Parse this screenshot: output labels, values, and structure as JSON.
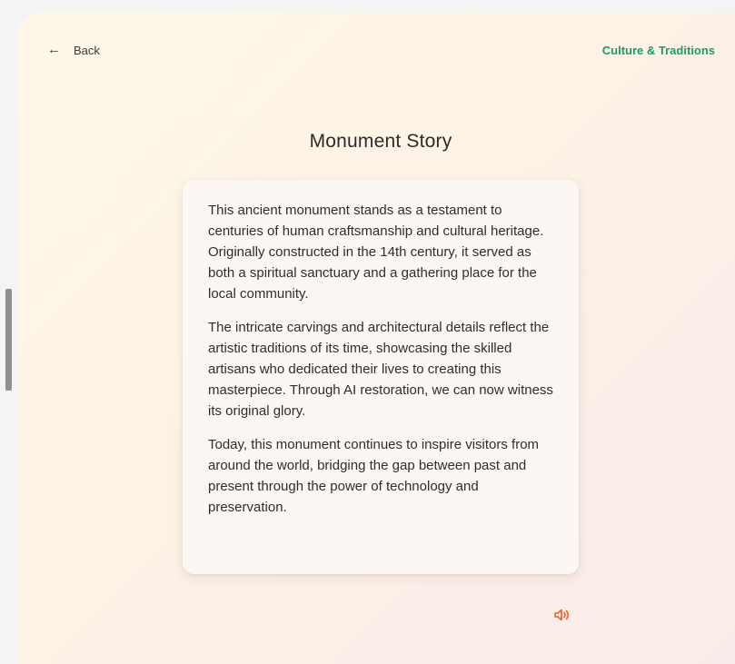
{
  "nav": {
    "back_label": "Back",
    "back_icon": "arrow-left-icon",
    "category": "Culture & Traditions"
  },
  "page": {
    "title": "Monument Story"
  },
  "story": {
    "paragraphs": [
      "This ancient monument stands as a testament to centuries of human craftsmanship and cultural heritage. Originally constructed in the 14th century, it served as both a spiritual sanctuary and a gathering place for the local community.",
      "The intricate carvings and architectural details reflect the artistic traditions of its time, showcasing the skilled artisans who dedicated their lives to creating this masterpiece. Through AI restoration, we can now witness its original glory.",
      "Today, this monument continues to inspire visitors from around the world, bridging the gap between past and present through the power of technology and preservation."
    ]
  },
  "audio": {
    "icon": "speaker-icon",
    "color": "#e8632b"
  },
  "colors": {
    "accent_green": "#1f9a6e",
    "card_background": "#fdf7f4"
  }
}
